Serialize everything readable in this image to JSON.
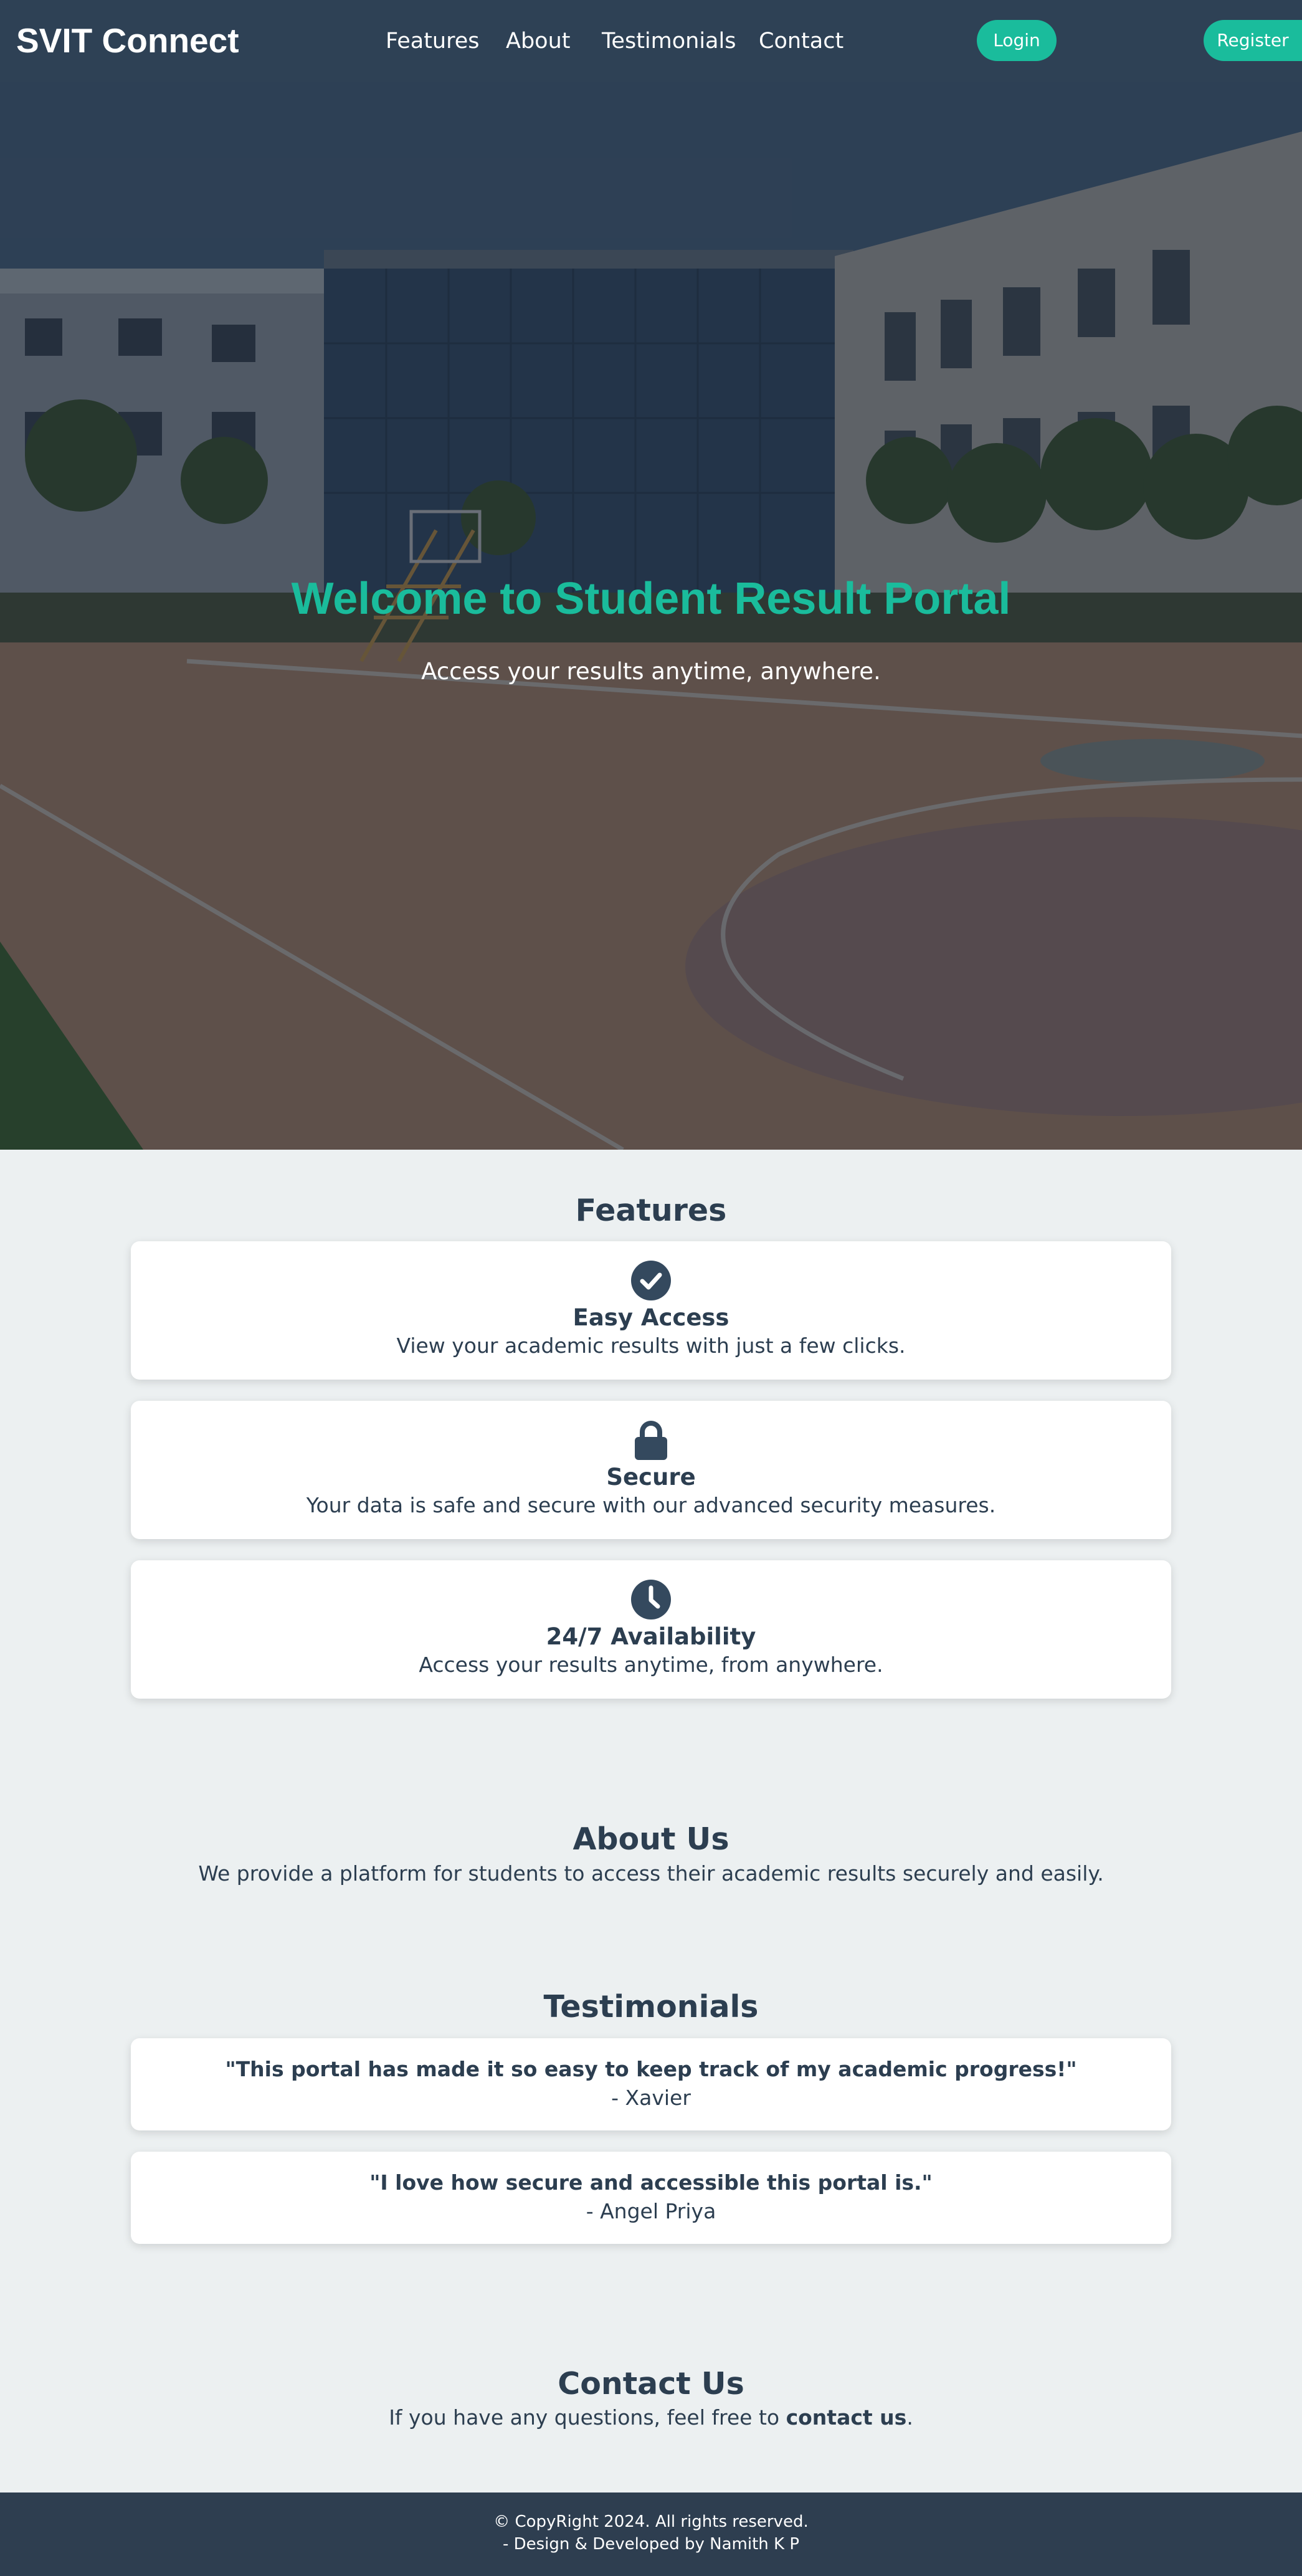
{
  "brand": "SVIT Connect",
  "nav": {
    "links": [
      "Features",
      "About",
      "Testimonials",
      "Contact"
    ],
    "login_label": "Login",
    "register_label": "Register"
  },
  "hero": {
    "title": "Welcome to Student Result Portal",
    "subtitle": "Access your results anytime, anywhere."
  },
  "features": {
    "heading": "Features",
    "items": [
      {
        "icon": "check-circle-icon",
        "title": "Easy Access",
        "desc": "View your academic results with just a few clicks."
      },
      {
        "icon": "lock-icon",
        "title": "Secure",
        "desc": "Your data is safe and secure with our advanced security measures."
      },
      {
        "icon": "clock-icon",
        "title": "24/7 Availability",
        "desc": "Access your results anytime, from anywhere."
      }
    ]
  },
  "about": {
    "heading": "About Us",
    "text": "We provide a platform for students to access their academic results securely and easily."
  },
  "testimonials": {
    "heading": "Testimonials",
    "items": [
      {
        "quote": "\"This portal has made it so easy to keep track of my academic progress!\"",
        "author": "- Xavier"
      },
      {
        "quote": "\"I love how secure and accessible this portal is.\"",
        "author": "- Angel Priya"
      }
    ]
  },
  "contact": {
    "heading": "Contact Us",
    "text_before": "If you have any questions, feel free to ",
    "link": "contact us",
    "text_after": "."
  },
  "footer": {
    "line1": "© CopyRight 2024. All rights reserved.",
    "line2": "- Design & Developed by Namith K P"
  },
  "colors": {
    "accent": "#1abc9c",
    "navbar": "#2e4155",
    "text": "#2c3e50",
    "page_bg": "#ecf0f1",
    "footer": "#2e3e50"
  }
}
